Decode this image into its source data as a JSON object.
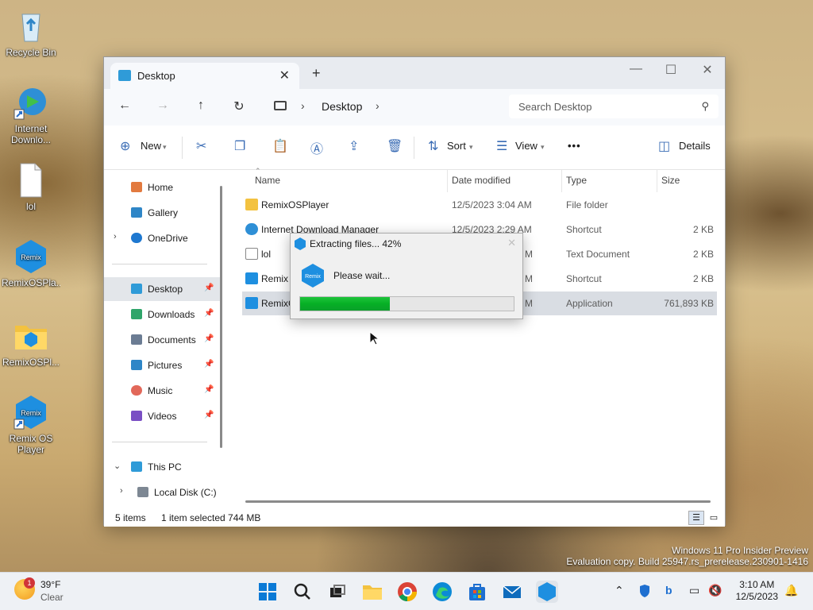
{
  "desktop": {
    "icons": [
      {
        "label": "Recycle Bin"
      },
      {
        "label": "Internet Downlo..."
      },
      {
        "label": "lol"
      },
      {
        "label": "RemixOSPla..."
      },
      {
        "label": "RemixOSPl..."
      },
      {
        "label": "Remix OS Player"
      }
    ]
  },
  "window": {
    "tab_title": "Desktop",
    "tab_close": "✕",
    "new_tab": "+",
    "minimize": "—",
    "maximize": "☐",
    "close": "✕"
  },
  "navbar": {
    "back": "←",
    "forward": "→",
    "up": "↑",
    "refresh": "↻",
    "breadcrumb": "Desktop",
    "search_placeholder": "Search Desktop"
  },
  "toolbar": {
    "new_label": "New",
    "sort_label": "Sort",
    "view_label": "View",
    "more": "•••",
    "details_label": "Details"
  },
  "navpane": {
    "items": [
      {
        "label": "Home",
        "pinned": false
      },
      {
        "label": "Gallery",
        "pinned": false
      },
      {
        "label": "OneDrive",
        "pinned": false
      },
      {
        "label": "Desktop",
        "pinned": true
      },
      {
        "label": "Downloads",
        "pinned": true
      },
      {
        "label": "Documents",
        "pinned": true
      },
      {
        "label": "Pictures",
        "pinned": true
      },
      {
        "label": "Music",
        "pinned": true
      },
      {
        "label": "Videos",
        "pinned": true
      },
      {
        "label": "This PC",
        "pinned": false
      },
      {
        "label": "Local Disk (C:)",
        "pinned": false
      }
    ]
  },
  "filelist": {
    "columns": [
      "Name",
      "Date modified",
      "Type",
      "Size"
    ],
    "rows": [
      {
        "name": "RemixOSPlayer",
        "date": "12/5/2023 3:04 AM",
        "type": "File folder",
        "size": ""
      },
      {
        "name": "Internet Download Manager",
        "date": "12/5/2023 2:29 AM",
        "type": "Shortcut",
        "size": "2 KB"
      },
      {
        "name": "lol",
        "date": "M",
        "type": "Text Document",
        "size": "2 KB"
      },
      {
        "name": "Remix C",
        "date": "M",
        "type": "Shortcut",
        "size": "2 KB"
      },
      {
        "name": "RemixC",
        "date": "M",
        "type": "Application",
        "size": "761,893 KB"
      }
    ]
  },
  "status": {
    "items_count": "5 items",
    "selection": "1 item selected  744 MB"
  },
  "dialog": {
    "title": "Extracting files... 42%",
    "message": "Please wait...",
    "close": "✕",
    "progress": 0.42
  },
  "watermark": {
    "line1": "Windows 11 Pro Insider Preview",
    "line2": "Evaluation copy. Build 25947.rs_prerelease.230901-1416"
  },
  "taskbar": {
    "weather_temp": "39°F",
    "weather_desc": "Clear",
    "weather_badge": "1",
    "time": "3:10 AM",
    "date": "12/5/2023"
  },
  "colors": {
    "accent": "#0067c0",
    "progress": "#06b025"
  }
}
